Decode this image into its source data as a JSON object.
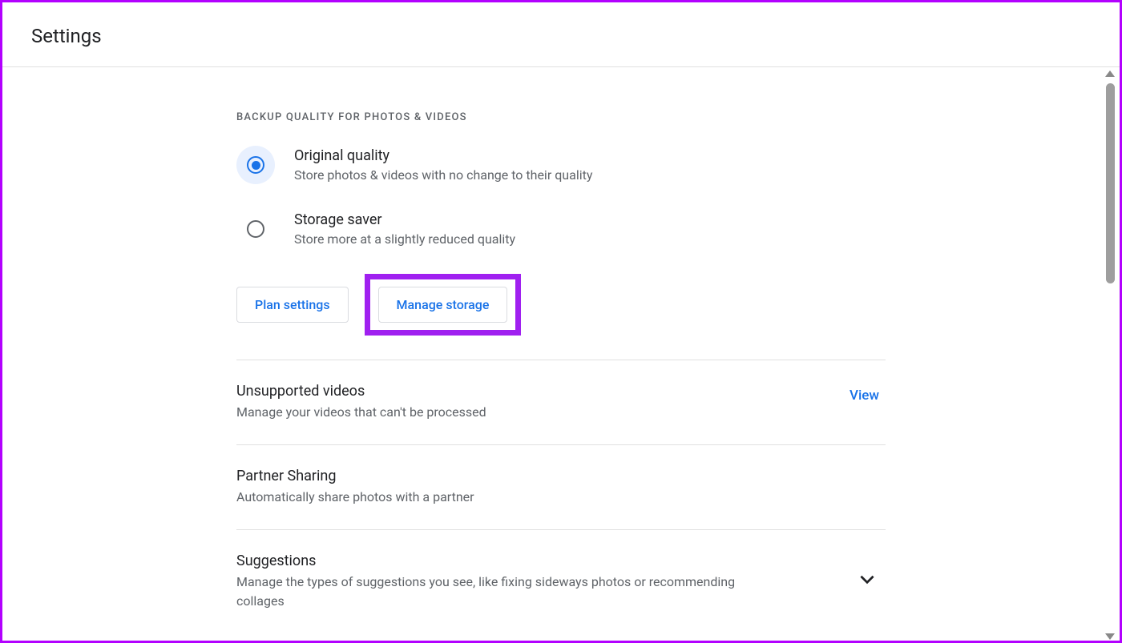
{
  "header": {
    "title": "Settings"
  },
  "backup_quality": {
    "section_label": "BACKUP QUALITY FOR PHOTOS & VIDEOS",
    "options": {
      "original": {
        "title": "Original quality",
        "desc": "Store photos & videos with no change to their quality"
      },
      "storage_saver": {
        "title": "Storage saver",
        "desc": "Store more at a slightly reduced quality"
      }
    },
    "buttons": {
      "plan_settings": "Plan settings",
      "manage_storage": "Manage storage"
    }
  },
  "rows": {
    "unsupported_videos": {
      "title": "Unsupported videos",
      "desc": "Manage your videos that can't be processed",
      "action": "View"
    },
    "partner_sharing": {
      "title": "Partner Sharing",
      "desc": "Automatically share photos with a partner"
    },
    "suggestions": {
      "title": "Suggestions",
      "desc": "Manage the types of suggestions you see, like fixing sideways photos or recommending collages"
    }
  }
}
